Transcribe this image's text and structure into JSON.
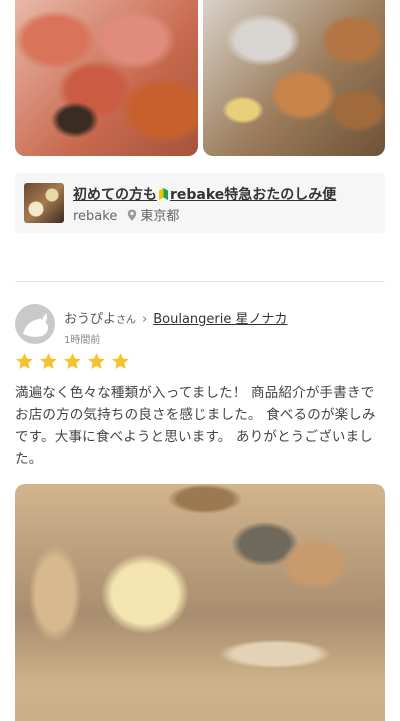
{
  "shop_card": {
    "title_prefix": "初めての方も",
    "title_suffix": "rebake特急おたのしみ便",
    "seller": "rebake",
    "location": "東京都"
  },
  "review": {
    "reviewer": "おうぴよ",
    "honorific": "さん",
    "shop_name": "Boulangerie 星ノナカ",
    "time_ago": "1時間前",
    "rating": 5,
    "text": "満遍なく色々な種類が入ってました！ 商品紹介が手書きでお店の方の気持ちの良さを感じました。 食べるのが楽しみです。大事に食べようと思います。 ありがとうございました。"
  },
  "colors": {
    "star": "#f5c232",
    "card_bg": "#f6f6f6",
    "avatar_bg": "#c9c9c9"
  }
}
